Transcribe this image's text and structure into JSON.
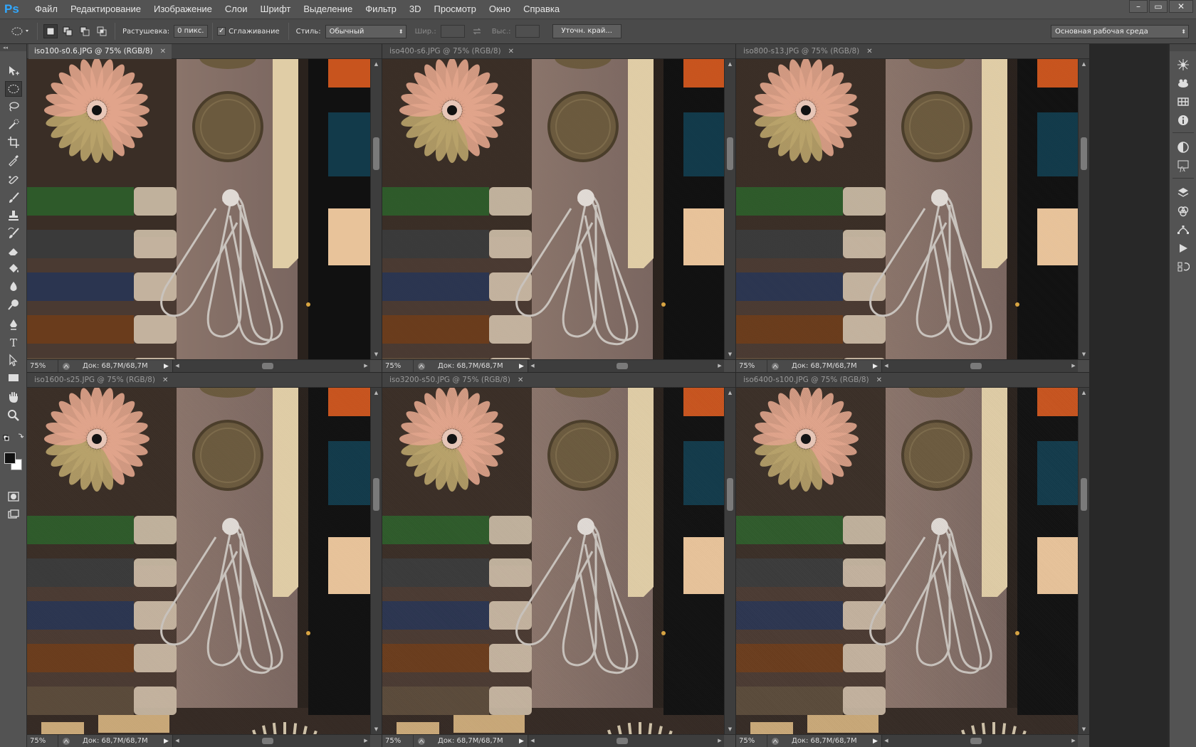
{
  "app": {
    "logo": "Ps"
  },
  "menu": [
    "Файл",
    "Редактирование",
    "Изображение",
    "Слои",
    "Шрифт",
    "Выделение",
    "Фильтр",
    "3D",
    "Просмотр",
    "Окно",
    "Справка"
  ],
  "window_controls": {
    "minimize": "–",
    "restore": "▭",
    "close": "✕"
  },
  "options": {
    "feather_label": "Растушевка:",
    "feather_value": "0 пикс.",
    "antialias_label": "Сглаживание",
    "antialias_checked": true,
    "style_label": "Стиль:",
    "style_value": "Обычный",
    "width_label": "Шир.:",
    "height_label": "Выс.:",
    "refine_button": "Уточн. край...",
    "workspace_value": "Основная рабочая среда"
  },
  "toolbox": {
    "head": "◂◂",
    "tools": [
      "move",
      "elliptical-marquee",
      "lasso",
      "quick-selection",
      "crop",
      "eyedropper",
      "spot-healing",
      "brush",
      "clone-stamp",
      "history-brush",
      "eraser",
      "paint-bucket",
      "blur",
      "dodge",
      "pen",
      "type",
      "path-selection",
      "rectangle",
      "hand",
      "zoom"
    ],
    "active_tool": "elliptical-marquee"
  },
  "documents": [
    {
      "title": "iso100-s0.6.JPG @ 75% (RGB/8)",
      "zoom": "75%",
      "doc_size": "Док: 68,7M/68,7M",
      "active": true,
      "noise": 0.0
    },
    {
      "title": "iso400-s6.JPG @ 75% (RGB/8)",
      "zoom": "75%",
      "doc_size": "Док: 68,7M/68,7M",
      "active": false,
      "noise": 0.05
    },
    {
      "title": "iso800-s13.JPG @ 75% (RGB/8)",
      "zoom": "75%",
      "doc_size": "Док: 68,7M/68,7M",
      "active": false,
      "noise": 0.1
    },
    {
      "title": "iso1600-s25.JPG @ 75% (RGB/8)",
      "zoom": "75%",
      "doc_size": "Док: 68,7M/68,7M",
      "active": false,
      "noise": 0.18
    },
    {
      "title": "iso3200-s50.JPG @ 75% (RGB/8)",
      "zoom": "75%",
      "doc_size": "Док: 68,7M/68,7M",
      "active": false,
      "noise": 0.28
    },
    {
      "title": "iso6400-s100.JPG @ 75% (RGB/8)",
      "zoom": "75%",
      "doc_size": "Док: 68,7M/68,7M",
      "active": false,
      "noise": 0.4
    }
  ],
  "panels": [
    "3d-axis",
    "3d-scene",
    "swatches",
    "info",
    "adjustments",
    "styles",
    "layers",
    "channels",
    "paths",
    "actions",
    "history"
  ],
  "colors": {
    "accent": "#31a8ff",
    "ui_bg": "#535353",
    "ui_dark": "#282828"
  }
}
